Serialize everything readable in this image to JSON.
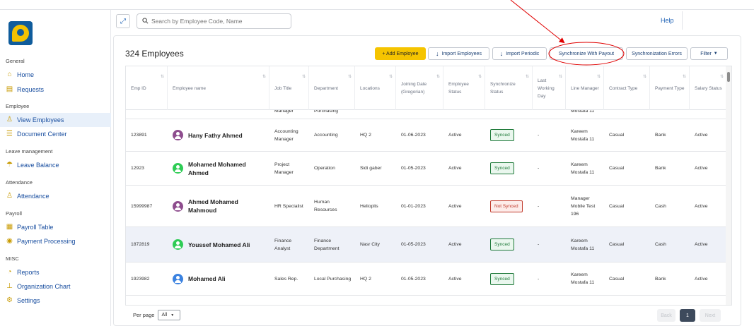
{
  "sidebar": {
    "sections": [
      {
        "title": "General",
        "items": [
          {
            "label": "Home",
            "icon": "home-icon"
          },
          {
            "label": "Requests",
            "icon": "requests-icon"
          }
        ]
      },
      {
        "title": "Employee",
        "items": [
          {
            "label": "View Employees",
            "icon": "users-icon",
            "active": true
          },
          {
            "label": "Document Center",
            "icon": "document-icon"
          }
        ]
      },
      {
        "title": "Leave management",
        "items": [
          {
            "label": "Leave Balance",
            "icon": "leave-icon"
          }
        ]
      },
      {
        "title": "Attendance",
        "items": [
          {
            "label": "Attendance",
            "icon": "attendance-icon"
          }
        ]
      },
      {
        "title": "Payroll",
        "items": [
          {
            "label": "Payroll Table",
            "icon": "table-icon"
          },
          {
            "label": "Payment Processing",
            "icon": "payment-icon"
          }
        ]
      },
      {
        "title": "MISC",
        "items": [
          {
            "label": "Reports",
            "icon": "pie-chart-icon"
          },
          {
            "label": "Organization Chart",
            "icon": "org-chart-icon"
          },
          {
            "label": "Settings",
            "icon": "gear-icon"
          }
        ]
      }
    ]
  },
  "header": {
    "search_placeholder": "Search by Employee Code, Name",
    "help_label": "Help"
  },
  "main": {
    "count_label": "324 Employees",
    "buttons": {
      "add": "+ Add Employee",
      "import_employees": "Import Employees",
      "import_periodic": "Import Periodic",
      "sync_payout": "Synchronize With Payout",
      "sync_errors": "Synchronization Errors",
      "filter": "Filter"
    }
  },
  "table": {
    "columns": [
      "Emp ID",
      "Employee name",
      "Job Title",
      "Department",
      "Locations",
      "Joining Date (Gregorian)",
      "Employee Status",
      "Synchronize Status",
      "Last Working Day",
      "Line Manager",
      "Contract Type",
      "Payment Type",
      "Salary Status"
    ],
    "partial_row": {
      "job": "Manager",
      "department": "Purchasing",
      "manager": "Mostafa 11"
    },
    "rows": [
      {
        "id": "123891",
        "name": "Hany Fathy Ahmed",
        "avatar_color": "#8e4d8e",
        "job": "Accounting Manager",
        "department": "Accounting",
        "location": "HQ 2",
        "joining": "01-06-2023",
        "status": "Active",
        "sync": "Synced",
        "last_day": "-",
        "manager": "Kareem Mostafa 11",
        "contract": "Casual",
        "payment": "Bank",
        "salary": "Active"
      },
      {
        "id": "12923",
        "name": "Mohamed Mohamed Ahmed",
        "avatar_color": "#2ecc55",
        "job": "Project Manager",
        "department": "Operation",
        "location": "Sidi gaber",
        "joining": "01-05-2023",
        "status": "Active",
        "sync": "Synced",
        "last_day": "-",
        "manager": "Kareem Mostafa 11",
        "contract": "Casual",
        "payment": "Bank",
        "salary": "Active"
      },
      {
        "id": "15999987",
        "name": "Ahmed Mohamed Mahmoud",
        "avatar_color": "#8e4d8e",
        "job": "HR Specialist",
        "department": "Human Resources",
        "location": "Helioplis",
        "joining": "01-01-2023",
        "status": "Active",
        "sync": "Not Synced",
        "last_day": "-",
        "manager": "Manager Mobile Test 196",
        "contract": "Casual",
        "payment": "Cash",
        "salary": "Active"
      },
      {
        "id": "1872819",
        "name": "Youssef Mohamed Ali",
        "avatar_color": "#2ecc55",
        "job": "Finance Analyst",
        "department": "Finance Department",
        "location": "Nasr City",
        "joining": "01-05-2023",
        "status": "Active",
        "sync": "Synced",
        "last_day": "-",
        "manager": "Kareem Mostafa 11",
        "contract": "Casual",
        "payment": "Cash",
        "salary": "Active"
      },
      {
        "id": "1923982",
        "name": "Mohamed Ali",
        "avatar_color": "#3b82e0",
        "job": "Sales Rep.",
        "department": "Local Purchasing",
        "location": "HQ 2",
        "joining": "01-05-2023",
        "status": "Active",
        "sync": "Synced",
        "last_day": "-",
        "manager": "Kareem Mostafa 11",
        "contract": "Casual",
        "payment": "Bank",
        "salary": "Active"
      }
    ]
  },
  "pagination": {
    "per_page_label": "Per page",
    "per_page_value": "All",
    "back": "Back",
    "current": "1",
    "next": "Next"
  },
  "colors": {
    "accent": "#f5c400",
    "link": "#1a4fa0",
    "synced": "#1f7a3a",
    "not_synced": "#c0392b",
    "annotation": "#e00000"
  }
}
